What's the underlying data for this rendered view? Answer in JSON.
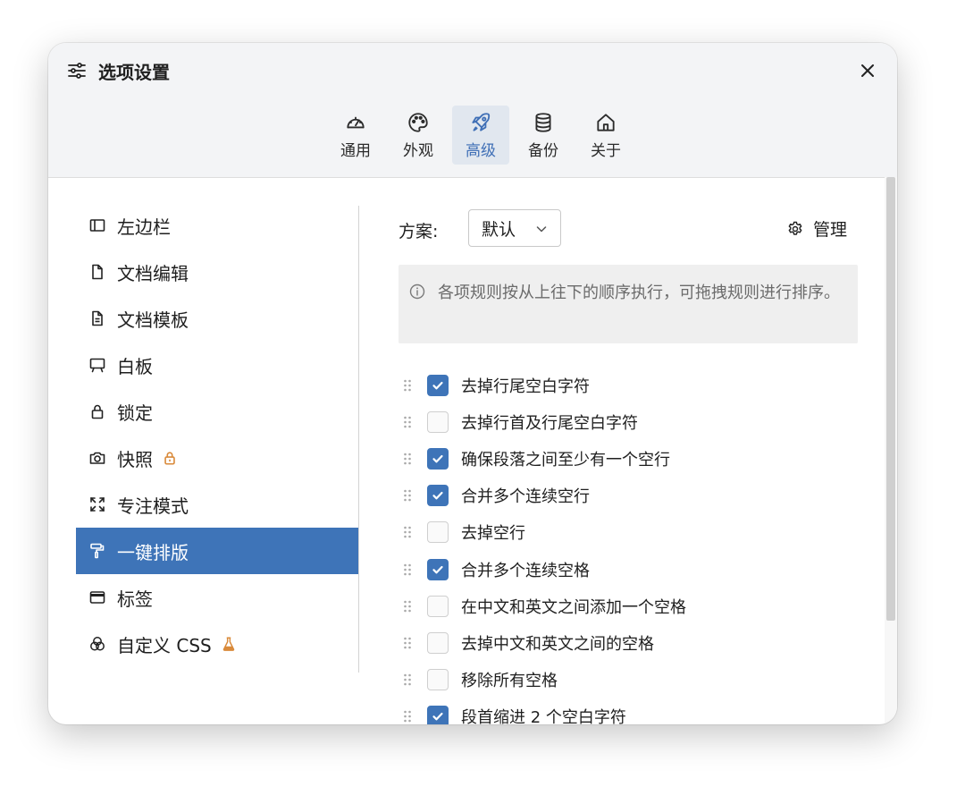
{
  "window": {
    "title": "选项设置"
  },
  "tabs": [
    {
      "label": "通用",
      "icon": "gauge-icon",
      "active": false
    },
    {
      "label": "外观",
      "icon": "palette-icon",
      "active": false
    },
    {
      "label": "高级",
      "icon": "rocket-icon",
      "active": true
    },
    {
      "label": "备份",
      "icon": "database-icon",
      "active": false
    },
    {
      "label": "关于",
      "icon": "home-icon",
      "active": false
    }
  ],
  "sidebar": {
    "items": [
      {
        "label": "左边栏",
        "icon": "sidebar-panel-icon"
      },
      {
        "label": "文档编辑",
        "icon": "file-icon"
      },
      {
        "label": "文档模板",
        "icon": "file-text-icon"
      },
      {
        "label": "白板",
        "icon": "whiteboard-icon"
      },
      {
        "label": "锁定",
        "icon": "lock-icon"
      },
      {
        "label": "快照",
        "icon": "camera-icon",
        "badge": "lock-badge-icon"
      },
      {
        "label": "专注模式",
        "icon": "expand-icon"
      },
      {
        "label": "一键排版",
        "icon": "paint-roller-icon",
        "active": true
      },
      {
        "label": "标签",
        "icon": "tag-window-icon"
      },
      {
        "label": "自定义 CSS",
        "icon": "circles-icon",
        "badge": "flask-badge-icon"
      }
    ]
  },
  "content": {
    "scheme_label": "方案:",
    "scheme_value": "默认",
    "manage_label": "管理",
    "notice": "各项规则按从上往下的顺序执行，可拖拽规则进行排序。",
    "rules": [
      {
        "label": "去掉行尾空白字符",
        "checked": true
      },
      {
        "label": "去掉行首及行尾空白字符",
        "checked": false
      },
      {
        "label": "确保段落之间至少有一个空行",
        "checked": true
      },
      {
        "label": "合并多个连续空行",
        "checked": true
      },
      {
        "label": "去掉空行",
        "checked": false
      },
      {
        "label": "合并多个连续空格",
        "checked": true
      },
      {
        "label": "在中文和英文之间添加一个空格",
        "checked": false
      },
      {
        "label": "去掉中文和英文之间的空格",
        "checked": false
      },
      {
        "label": "移除所有空格",
        "checked": false
      },
      {
        "label": "段首缩进 2 个空白字符",
        "checked": true
      }
    ]
  },
  "colors": {
    "accent": "#3e74b8",
    "badge": "#d98a3a",
    "header_bg": "#f3f4f6"
  }
}
